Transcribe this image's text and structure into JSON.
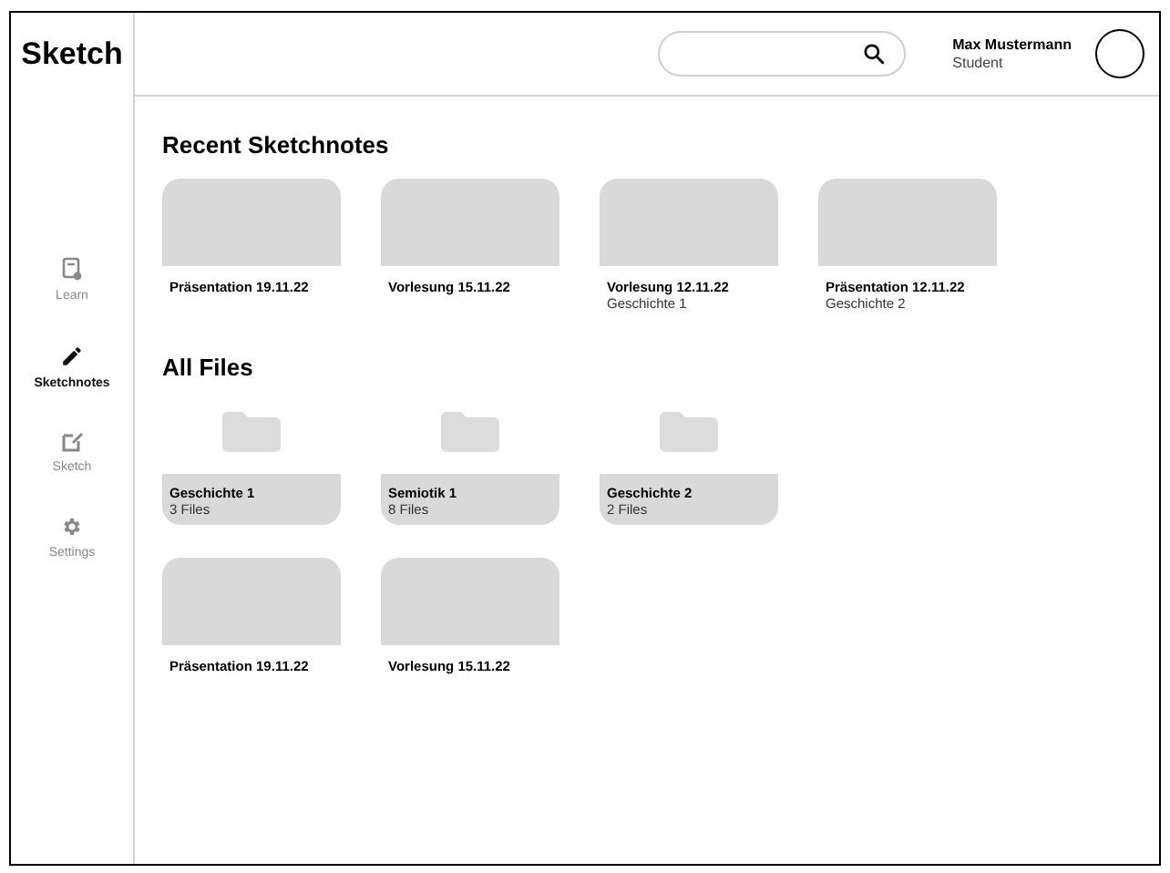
{
  "app": {
    "title": "Sketch"
  },
  "sidebar": {
    "items": [
      {
        "label": "Learn",
        "kind": "learn",
        "selected": false
      },
      {
        "label": "Sketchnotes",
        "kind": "pencil",
        "selected": true
      },
      {
        "label": "Sketch",
        "kind": "sketch",
        "selected": false
      },
      {
        "label": "Settings",
        "kind": "settings",
        "selected": false
      }
    ]
  },
  "header": {
    "user": {
      "name": "Max Mustermann",
      "role": "Student"
    }
  },
  "recent": {
    "title": "Recent Sketchnotes",
    "items": [
      {
        "title": "Präsentation 19.11.22"
      },
      {
        "title": "Vorlesung 15.11.22"
      },
      {
        "title": "Vorlesung 12.11.22",
        "subtitle": "Geschichte 1"
      },
      {
        "title": "Präsentation 12.11.22",
        "subtitle": "Geschichte 2"
      }
    ]
  },
  "all_files": {
    "title": "All Files",
    "folders": [
      {
        "name": "Geschichte 1",
        "count": "3 Files"
      },
      {
        "name": "Semiotik 1",
        "count": "8 Files"
      },
      {
        "name": "Geschichte 2",
        "count": "2 Files"
      }
    ],
    "sketchnotes": [
      {
        "title": "Präsentation 19.11.22"
      },
      {
        "title": "Vorlesung 15.11.22"
      }
    ]
  }
}
